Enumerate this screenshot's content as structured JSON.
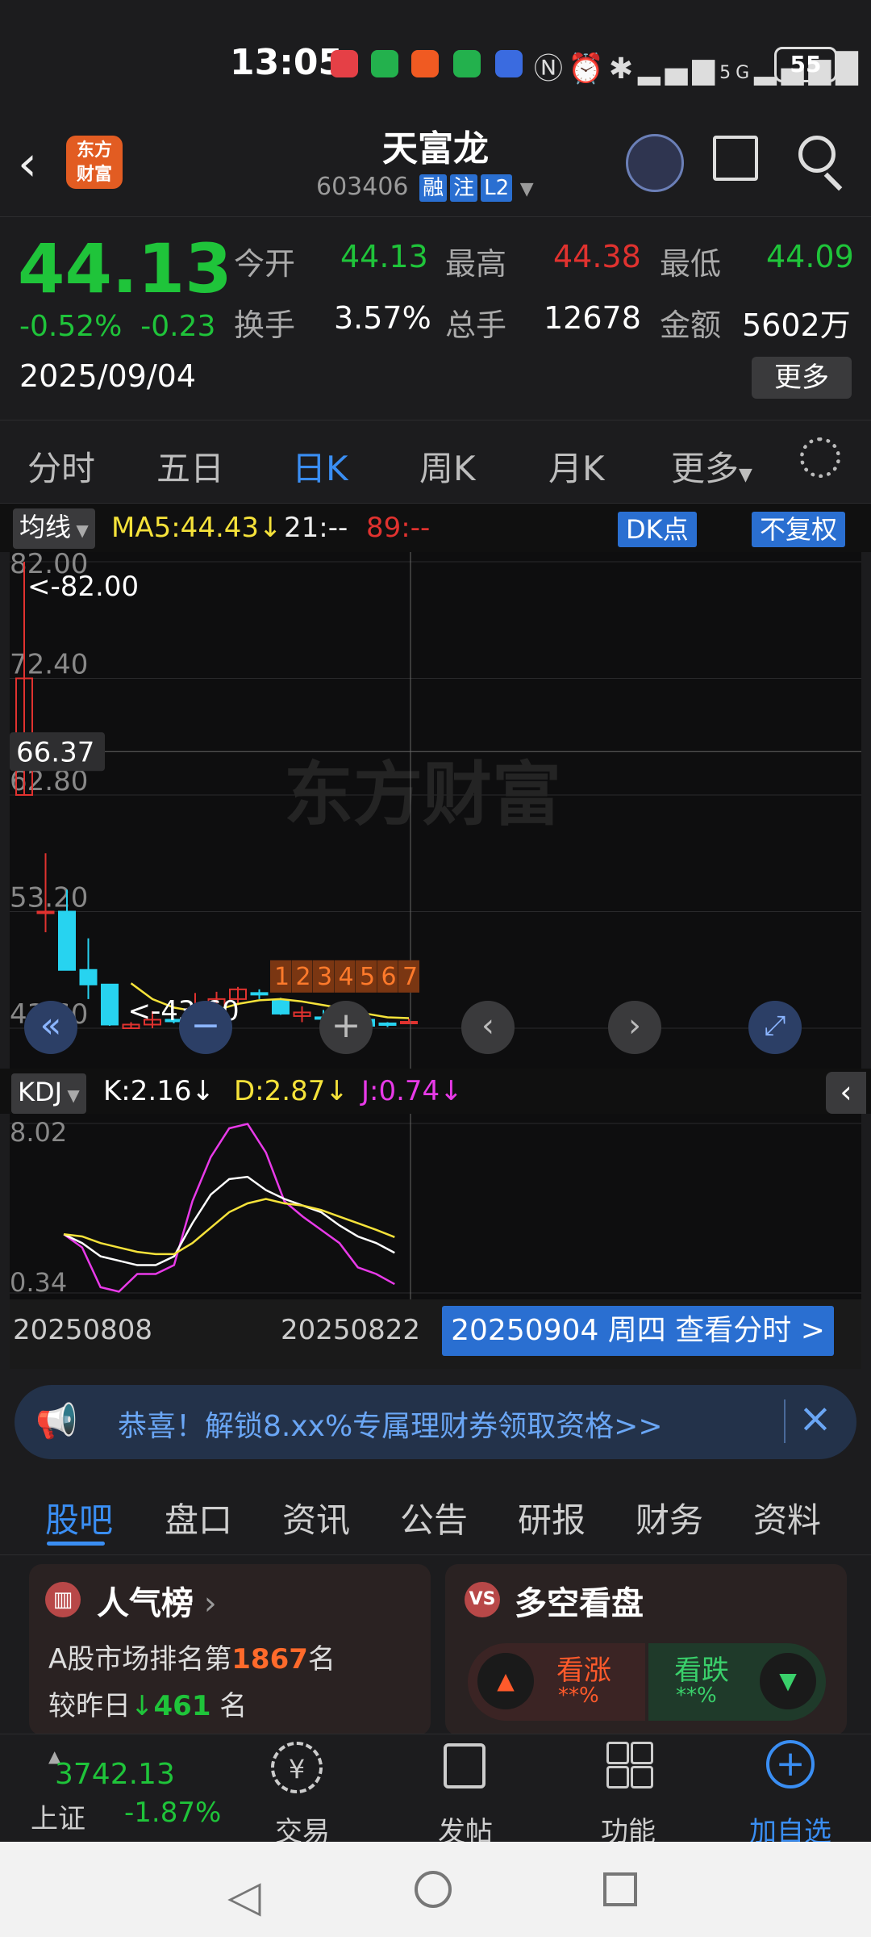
{
  "status_bar": {
    "time": "13:05",
    "battery": "55",
    "network": "5G"
  },
  "header": {
    "logo_text_line1": "东方",
    "logo_text_line2": "财富",
    "stock_name": "天富龙",
    "stock_code": "603406",
    "tags": [
      "融",
      "注",
      "L2"
    ]
  },
  "quote": {
    "price": "44.13",
    "change_pct": "-0.52%",
    "change_abs": "-0.23",
    "date": "2025/09/04",
    "open_label": "今开",
    "open": "44.13",
    "high_label": "最高",
    "high": "44.38",
    "low_label": "最低",
    "low": "44.09",
    "turnover_label": "换手",
    "turnover": "3.57%",
    "volume_label": "总手",
    "volume": "12678",
    "amount_label": "金额",
    "amount": "5602万",
    "more_label": "更多"
  },
  "period_tabs": [
    "分时",
    "五日",
    "日K",
    "周K",
    "月K",
    "更多"
  ],
  "active_period": "日K",
  "ma_row": {
    "label": "均线",
    "ma5": "MA5:44.43",
    "ma21": "21:--",
    "ma89": "89:--",
    "dk_label": "DK点",
    "adjust_label": "不复权"
  },
  "kchart": {
    "y_ticks": [
      "82.00",
      "72.40",
      "62.80",
      "53.20",
      "43.60"
    ],
    "max_marker": "<-82.00",
    "min_marker": "<-43.60",
    "crosshair_value": "66.37",
    "watermark": "东方财富",
    "numbered_markers": [
      "1",
      "2",
      "3",
      "4",
      "5",
      "6",
      "7"
    ]
  },
  "kdj_row": {
    "label": "KDJ",
    "k": "K:2.16",
    "d": "D:2.87",
    "j": "J:0.74"
  },
  "kdj": {
    "y_ticks": [
      "8.02",
      "0.34"
    ]
  },
  "date_axis": {
    "start": "20250808",
    "mid": "20250822",
    "selected": "20250904 周四 查看分时 >"
  },
  "banner": {
    "text": "恭喜！解锁8.xx%专属理财券领取资格>>"
  },
  "info_tabs": [
    "股吧",
    "盘口",
    "资讯",
    "公告",
    "研报",
    "财务",
    "资料"
  ],
  "active_info_tab": "股吧",
  "popularity_card": {
    "title": "人气榜",
    "rank_prefix": "A股市场排名第",
    "rank": "1867",
    "rank_suffix": "名",
    "compare_prefix": "较昨日",
    "compare_value": "461",
    "compare_suffix": "名"
  },
  "sentiment_card": {
    "title": "多空看盘",
    "bull_label": "看涨",
    "bull_value": "**%",
    "bear_label": "看跌",
    "bear_value": "**%"
  },
  "bottom_nav": {
    "index_value": "3742.13",
    "index_name": "上证",
    "index_change": "-1.87%",
    "items": [
      "交易",
      "发帖",
      "功能",
      "加自选"
    ]
  },
  "colors": {
    "up": "#e0322f",
    "down": "#1fc43a",
    "accent": "#3a8ef3",
    "cyan_candle": "#27d3f0"
  },
  "chart_data": {
    "type": "candlestick",
    "candles": [
      {
        "o": 62.8,
        "h": 82.0,
        "l": 62.8,
        "c": 72.4
      },
      {
        "o": 53.2,
        "h": 58.0,
        "l": 51.5,
        "c": 53.2
      },
      {
        "o": 53.2,
        "h": 55.0,
        "l": 48.4,
        "c": 48.4
      },
      {
        "o": 48.4,
        "h": 51.0,
        "l": 46.0,
        "c": 47.2
      },
      {
        "o": 47.2,
        "h": 47.2,
        "l": 43.8,
        "c": 43.9
      },
      {
        "o": 43.6,
        "h": 44.1,
        "l": 43.6,
        "c": 43.9
      },
      {
        "o": 43.9,
        "h": 45.0,
        "l": 43.6,
        "c": 44.3
      },
      {
        "o": 44.3,
        "h": 44.4,
        "l": 44.0,
        "c": 44.2
      },
      {
        "o": 44.0,
        "h": 46.5,
        "l": 43.8,
        "c": 45.2
      },
      {
        "o": 45.2,
        "h": 46.6,
        "l": 44.8,
        "c": 46.0
      },
      {
        "o": 46.0,
        "h": 47.0,
        "l": 45.5,
        "c": 46.8
      },
      {
        "o": 46.5,
        "h": 46.8,
        "l": 46.0,
        "c": 46.4
      },
      {
        "o": 45.9,
        "h": 46.1,
        "l": 44.7,
        "c": 44.8
      },
      {
        "o": 44.6,
        "h": 45.4,
        "l": 44.1,
        "c": 44.9
      },
      {
        "o": 44.5,
        "h": 45.1,
        "l": 44.2,
        "c": 44.4
      },
      {
        "o": 44.1,
        "h": 44.6,
        "l": 44.0,
        "c": 44.3
      },
      {
        "o": 44.3,
        "h": 44.4,
        "l": 43.7,
        "c": 43.8
      },
      {
        "o": 44.0,
        "h": 44.1,
        "l": 43.7,
        "c": 43.9
      },
      {
        "o": 44.13,
        "h": 44.38,
        "l": 44.09,
        "c": 44.13
      }
    ],
    "ma5": [
      null,
      null,
      null,
      null,
      null,
      47.3,
      46.0,
      45.3,
      45.0,
      45.1,
      45.6,
      45.9,
      46.0,
      45.8,
      45.5,
      45.2,
      44.8,
      44.5,
      44.43
    ],
    "kdj_k": [
      3.0,
      2.6,
      2.0,
      1.8,
      1.6,
      1.6,
      2.0,
      3.5,
      4.8,
      5.5,
      5.6,
      5.0,
      4.6,
      4.3,
      4.0,
      3.4,
      2.9,
      2.6,
      2.16
    ],
    "kdj_d": [
      3.0,
      2.9,
      2.6,
      2.4,
      2.2,
      2.1,
      2.1,
      2.6,
      3.3,
      4.0,
      4.4,
      4.6,
      4.4,
      4.3,
      4.1,
      3.8,
      3.5,
      3.2,
      2.87
    ],
    "kdj_j": [
      3.0,
      2.4,
      0.6,
      0.4,
      1.2,
      1.2,
      1.6,
      4.5,
      6.5,
      7.8,
      8.0,
      6.7,
      4.5,
      3.8,
      3.2,
      2.6,
      1.5,
      1.2,
      0.74
    ]
  }
}
